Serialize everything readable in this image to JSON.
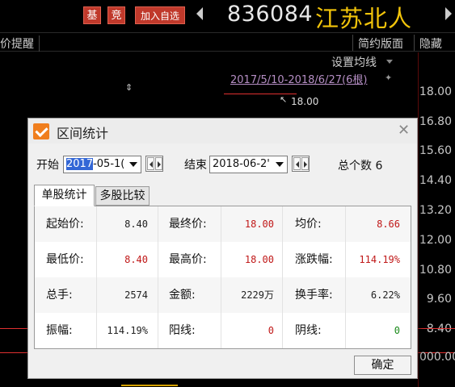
{
  "header": {
    "tag_ji": "基",
    "tag_jing": "竞",
    "add_watch_label": "加入自选",
    "stock_code": "836084",
    "stock_name": "江苏北人"
  },
  "toolbar": {
    "alert_label": "价提醒",
    "simple_layout_label": "简约版面",
    "hide_label": "隐藏"
  },
  "chart": {
    "ma_setting_label": "设置均线",
    "range_label": "2017/5/10-2018/6/27(6根)",
    "cursor_price": "18.00",
    "price_ticks": [
      "18.00",
      "16.80",
      "15.60",
      "14.40",
      "13.20",
      "12.00",
      "10.80",
      "9.60",
      "8.40"
    ],
    "volume_tick": "000.00",
    "colors": {
      "stock_name": "#f2c40a",
      "up": "#e03030",
      "tag": "#c0392b",
      "range_label": "#b58ec4"
    }
  },
  "dialog": {
    "title": "区间统计",
    "start_label": "开始",
    "start_date_selected": "2017",
    "start_date_rest": "-05-1(",
    "end_label": "结束",
    "end_date": "2018-06-2'",
    "total_label": "总个数 6",
    "tabs": [
      "单股统计",
      "多股比较"
    ],
    "stats": [
      [
        {
          "k": "起始价:",
          "v": "8.40",
          "c": ""
        },
        {
          "k": "最终价:",
          "v": "18.00",
          "c": "red"
        },
        {
          "k": "均价:",
          "v": "8.66",
          "c": "red"
        }
      ],
      [
        {
          "k": "最低价:",
          "v": "8.40",
          "c": "red"
        },
        {
          "k": "最高价:",
          "v": "18.00",
          "c": "red"
        },
        {
          "k": "涨跌幅:",
          "v": "114.19%",
          "c": "red"
        }
      ],
      [
        {
          "k": "总手:",
          "v": "2574",
          "c": ""
        },
        {
          "k": "金额:",
          "v": "2229万",
          "c": ""
        },
        {
          "k": "换手率:",
          "v": "6.22%",
          "c": ""
        }
      ],
      [
        {
          "k": "振幅:",
          "v": "114.19%",
          "c": ""
        },
        {
          "k": "阳线:",
          "v": "0",
          "c": "red"
        },
        {
          "k": "阴线:",
          "v": "0",
          "c": "green"
        }
      ]
    ],
    "ok_label": "确定"
  }
}
